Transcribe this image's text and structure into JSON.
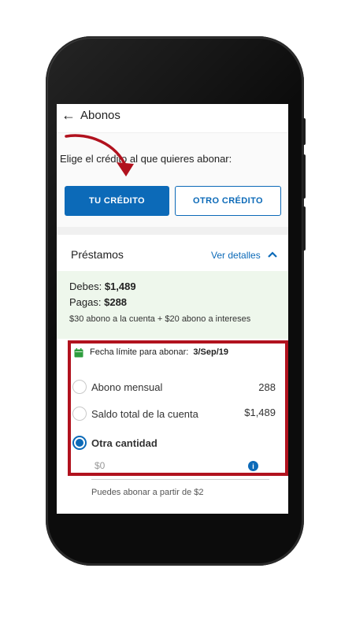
{
  "appbar": {
    "back_icon": "arrow-left-icon",
    "title": "Abonos"
  },
  "section_top": {
    "prompt": "Elige el crédito al que quieres abonar:",
    "button_primary": "TU CRÉDITO",
    "button_secondary": "OTRO CRÉDITO"
  },
  "prestamos": {
    "title": "Préstamos",
    "details_link": "Ver detalles",
    "debes_label": "Debes:",
    "debes_value": "$1,489",
    "pagas_label": "Pagas:",
    "pagas_value": "$288",
    "breakdown": "$30 abono a la cuenta + $20 abono a intereses"
  },
  "payment": {
    "deadline_label": "Fecha límite para abonar:",
    "deadline_value": "3/Sep/19",
    "options": [
      {
        "label": "Abono mensual",
        "amount": "288",
        "selected": false
      },
      {
        "label": "Saldo total de la cuenta",
        "amount": "$1,489",
        "selected": false
      },
      {
        "label": "Otra cantidad",
        "amount": "",
        "selected": true
      }
    ],
    "other_amount_placeholder": "$0",
    "hint": "Puedes abonar a partir de $2"
  },
  "colors": {
    "primary": "#0c6ab8",
    "highlight_frame": "#b1121e",
    "green_band": "#eef7ec",
    "calendar": "#2e9e3e"
  }
}
